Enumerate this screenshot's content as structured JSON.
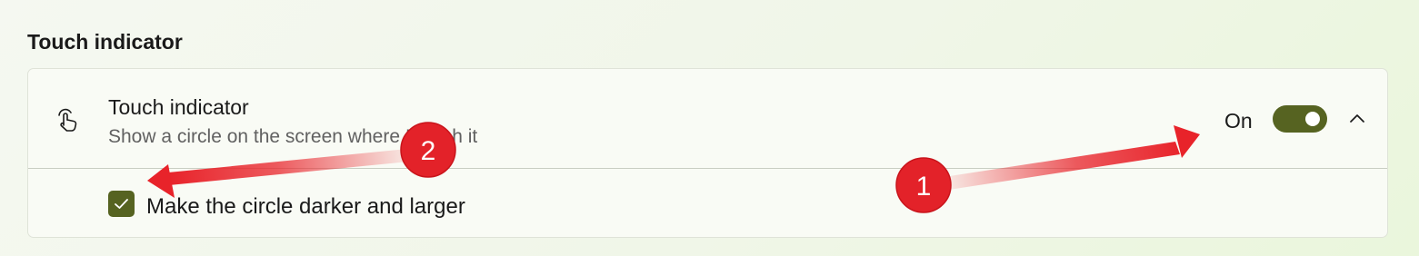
{
  "section": {
    "title": "Touch indicator"
  },
  "card": {
    "icon": "touch-hand-icon",
    "title": "Touch indicator",
    "description": "Show a circle on the screen where I touch it",
    "toggle": {
      "state_label": "On",
      "on": true
    },
    "expand_icon": "chevron-up-icon",
    "option": {
      "label": "Make the circle darker and larger",
      "checked": true,
      "icon": "checkmark-icon"
    }
  },
  "annotations": [
    {
      "number": "1",
      "points_to": "toggle"
    },
    {
      "number": "2",
      "points_to": "checkbox"
    }
  ],
  "colors": {
    "accent": "#566321",
    "annotation_red": "#e8232a"
  }
}
